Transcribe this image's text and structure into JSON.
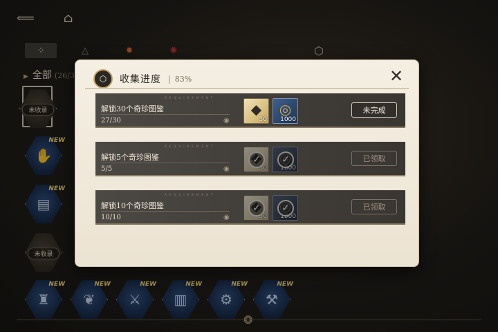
{
  "nav": {
    "back_icon": "back-arrow-icon",
    "home_icon": "home-icon"
  },
  "tabs": [
    {
      "name": "grid-icon",
      "active": true
    },
    {
      "name": "triangle-icon",
      "active": false
    },
    {
      "name": "gear-badge-icon",
      "active": false,
      "color": "#d06a2e"
    },
    {
      "name": "red-badge-icon",
      "active": false,
      "color": "#c0323a"
    }
  ],
  "category": {
    "label": "全部",
    "count": "(26/3"
  },
  "grid": {
    "new_tag": "NEW",
    "locked_tag": "未收录"
  },
  "modal": {
    "title": "收集进度",
    "separator": "|",
    "percent": "83%",
    "rows": [
      {
        "label": "解锁30个奇珍图鉴",
        "progress": "27/30",
        "deco": "REQUIREMENT",
        "rewards": [
          {
            "icon": "crystal-icon",
            "qty": "50"
          },
          {
            "icon": "gold-coin-icon",
            "qty": "1000"
          }
        ],
        "claimed": false,
        "status": "未完成"
      },
      {
        "label": "解锁5个奇珍图鉴",
        "progress": "5/5",
        "deco": "REQUIREMENT",
        "rewards": [
          {
            "icon": "crystal-icon",
            "qty": "50"
          },
          {
            "icon": "gold-coin-icon",
            "qty": "1000"
          }
        ],
        "claimed": true,
        "status": "已领取"
      },
      {
        "label": "解锁10个奇珍图鉴",
        "progress": "10/10",
        "deco": "REQUIREMENT",
        "rewards": [
          {
            "icon": "crystal-icon",
            "qty": "50"
          },
          {
            "icon": "gold-coin-icon",
            "qty": "1000"
          }
        ],
        "claimed": true,
        "status": "已领取"
      }
    ]
  },
  "colors": {
    "accent_gold": "#c4a56a",
    "modal_bg": "#f5efe3",
    "row_bg": "#4c4844"
  }
}
